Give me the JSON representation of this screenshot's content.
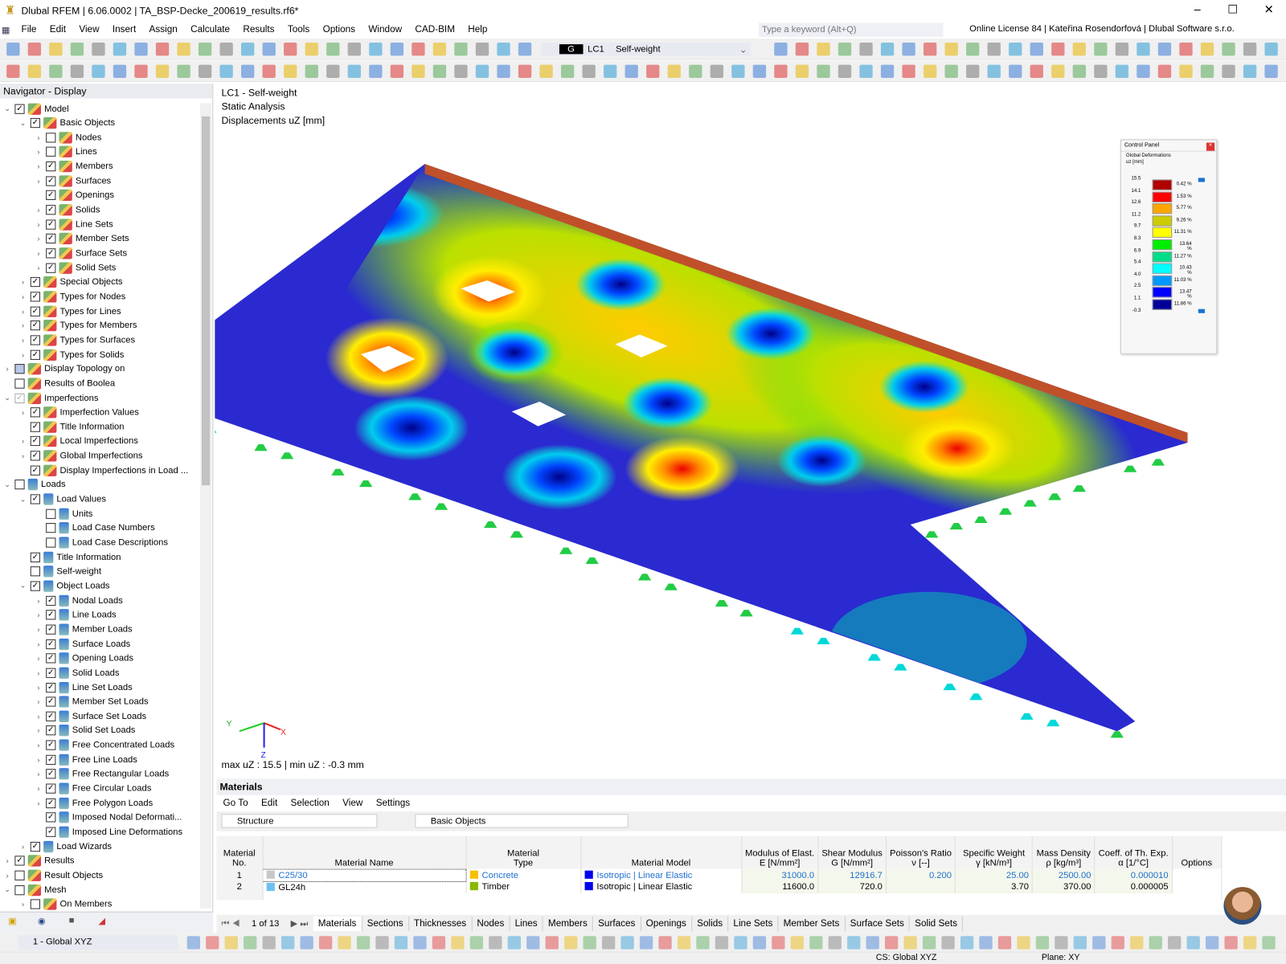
{
  "app": {
    "title": "Dlubal RFEM | 6.06.0002 | TA_BSP-Decke_200619_results.rf6*",
    "window_controls": [
      "–",
      "☐",
      "✕"
    ]
  },
  "menu": [
    "File",
    "Edit",
    "View",
    "Insert",
    "Assign",
    "Calculate",
    "Results",
    "Tools",
    "Options",
    "Window",
    "CAD-BIM",
    "Help"
  ],
  "search": {
    "placeholder": "Type a keyword (Alt+Q)"
  },
  "license": "Online License 84 | Kateřina Rosendorfová | Dlubal Software s.r.o.",
  "loadcase": {
    "type": "G",
    "id": "LC1",
    "name": "Self-weight"
  },
  "navigator": {
    "title": "Navigator - Display",
    "items": [
      [
        0,
        "v",
        1,
        "Model"
      ],
      [
        1,
        "v",
        1,
        "Basic Objects"
      ],
      [
        2,
        ">",
        0,
        "Nodes"
      ],
      [
        2,
        ">",
        0,
        "Lines"
      ],
      [
        2,
        ">",
        1,
        "Members"
      ],
      [
        2,
        ">",
        1,
        "Surfaces"
      ],
      [
        2,
        "",
        1,
        "Openings"
      ],
      [
        2,
        ">",
        1,
        "Solids"
      ],
      [
        2,
        ">",
        1,
        "Line Sets"
      ],
      [
        2,
        ">",
        1,
        "Member Sets"
      ],
      [
        2,
        ">",
        1,
        "Surface Sets"
      ],
      [
        2,
        ">",
        1,
        "Solid Sets"
      ],
      [
        1,
        ">",
        1,
        "Special Objects"
      ],
      [
        1,
        ">",
        1,
        "Types for Nodes"
      ],
      [
        1,
        ">",
        1,
        "Types for Lines"
      ],
      [
        1,
        ">",
        1,
        "Types for Members"
      ],
      [
        1,
        ">",
        1,
        "Types for Surfaces"
      ],
      [
        1,
        ">",
        1,
        "Types for Solids"
      ],
      [
        0,
        ">",
        2,
        "Display Topology on"
      ],
      [
        0,
        "",
        0,
        "Results of Boolea"
      ],
      [
        0,
        "v",
        3,
        "Imperfections"
      ],
      [
        1,
        ">",
        1,
        "Imperfection Values"
      ],
      [
        1,
        "",
        1,
        "Title Information"
      ],
      [
        1,
        ">",
        1,
        "Local Imperfections"
      ],
      [
        1,
        ">",
        1,
        "Global Imperfections"
      ],
      [
        1,
        "",
        1,
        "Display Imperfections in Load ..."
      ],
      [
        0,
        "v",
        0,
        "Loads"
      ],
      [
        1,
        "v",
        1,
        "Load Values"
      ],
      [
        2,
        "",
        0,
        "Units"
      ],
      [
        2,
        "",
        0,
        "Load Case Numbers"
      ],
      [
        2,
        "",
        0,
        "Load Case Descriptions"
      ],
      [
        1,
        "",
        1,
        "Title Information"
      ],
      [
        1,
        "",
        0,
        "Self-weight"
      ],
      [
        1,
        "v",
        1,
        "Object Loads"
      ],
      [
        2,
        ">",
        1,
        "Nodal Loads"
      ],
      [
        2,
        ">",
        1,
        "Line Loads"
      ],
      [
        2,
        ">",
        1,
        "Member Loads"
      ],
      [
        2,
        ">",
        1,
        "Surface Loads"
      ],
      [
        2,
        ">",
        1,
        "Opening Loads"
      ],
      [
        2,
        ">",
        1,
        "Solid Loads"
      ],
      [
        2,
        ">",
        1,
        "Line Set Loads"
      ],
      [
        2,
        ">",
        1,
        "Member Set Loads"
      ],
      [
        2,
        ">",
        1,
        "Surface Set Loads"
      ],
      [
        2,
        ">",
        1,
        "Solid Set Loads"
      ],
      [
        2,
        ">",
        1,
        "Free Concentrated Loads"
      ],
      [
        2,
        ">",
        1,
        "Free Line Loads"
      ],
      [
        2,
        ">",
        1,
        "Free Rectangular Loads"
      ],
      [
        2,
        ">",
        1,
        "Free Circular Loads"
      ],
      [
        2,
        ">",
        1,
        "Free Polygon Loads"
      ],
      [
        2,
        "",
        1,
        "Imposed Nodal Deformati..."
      ],
      [
        2,
        "",
        1,
        "Imposed Line Deformations"
      ],
      [
        1,
        ">",
        1,
        "Load Wizards"
      ],
      [
        0,
        ">",
        1,
        "Results"
      ],
      [
        0,
        ">",
        0,
        "Result Objects"
      ],
      [
        0,
        "v",
        0,
        "Mesh"
      ],
      [
        1,
        ">",
        0,
        "On Members"
      ]
    ]
  },
  "view": {
    "line1": "LC1 - Self-weight",
    "line2": "Static Analysis",
    "line3": "Displacements uZ [mm]",
    "footer": "max uZ : 15.5 | min uZ : -0.3 mm",
    "axes": {
      "x": "X",
      "y": "Y",
      "z": "Z"
    }
  },
  "control_panel": {
    "title": "Control Panel",
    "subtitle1": "Global Deformations",
    "subtitle2": "uz [mm]",
    "values": [
      "15.5",
      "14.1",
      "12.6",
      "11.2",
      "9.7",
      "8.3",
      "6.9",
      "5.4",
      "4.0",
      "2.5",
      "1.1",
      "-0.3"
    ],
    "colors": [
      "#b00000",
      "#ff0000",
      "#ffa500",
      "#cccc00",
      "#ffff00",
      "#00ee00",
      "#00dd88",
      "#00ffff",
      "#0099ff",
      "#0000ff",
      "#000099"
    ],
    "percents": [
      "0.42 %",
      "1.53 %",
      "5.77 %",
      "9.26 %",
      "11.31 %",
      "13.64 %",
      "11.27 %",
      "10.43 %",
      "11.03 %",
      "13.47 %",
      "11.86 %"
    ]
  },
  "materials": {
    "title": "Materials",
    "menu": [
      "Go To",
      "Edit",
      "Selection",
      "View",
      "Settings"
    ],
    "filter1": "Structure",
    "filter2": "Basic Objects",
    "columns": [
      [
        "Material",
        "No."
      ],
      [
        "",
        "Material Name"
      ],
      [
        "Material",
        "Type"
      ],
      [
        "",
        "Material Model"
      ],
      [
        "Modulus of Elast.",
        "E [N/mm²]"
      ],
      [
        "Shear Modulus",
        "G [N/mm²]"
      ],
      [
        "Poisson's Ratio",
        "ν [--]"
      ],
      [
        "Specific Weight",
        "γ [kN/m³]"
      ],
      [
        "Mass Density",
        "ρ [kg/m³]"
      ],
      [
        "Coeff. of Th. Exp.",
        "α [1/°C]"
      ],
      [
        "",
        "Options"
      ]
    ],
    "rows": [
      {
        "no": "1",
        "name": "C25/30",
        "name_color": "#c8c8c8",
        "type": "Concrete",
        "type_color": "#f5c000",
        "model": "Isotropic | Linear Elastic",
        "E": "31000.0",
        "G": "12916.7",
        "nu": "0.200",
        "gamma": "25.00",
        "rho": "2500.00",
        "alpha": "0.000010"
      },
      {
        "no": "2",
        "name": "GL24h",
        "name_color": "#6ec0f0",
        "type": "Timber",
        "type_color": "#88b800",
        "model": "Isotropic | Linear Elastic",
        "E": "11600.0",
        "G": "720.0",
        "nu": "",
        "gamma": "3.70",
        "rho": "370.00",
        "alpha": "0.000005"
      }
    ],
    "pager": "1 of 13",
    "tabs": [
      "Materials",
      "Sections",
      "Thicknesses",
      "Nodes",
      "Lines",
      "Members",
      "Surfaces",
      "Openings",
      "Solids",
      "Line Sets",
      "Member Sets",
      "Surface Sets",
      "Solid Sets"
    ]
  },
  "statusbar": {
    "cs_combo": "1 - Global XYZ",
    "cs": "CS: Global XYZ",
    "plane": "Plane: XY"
  }
}
